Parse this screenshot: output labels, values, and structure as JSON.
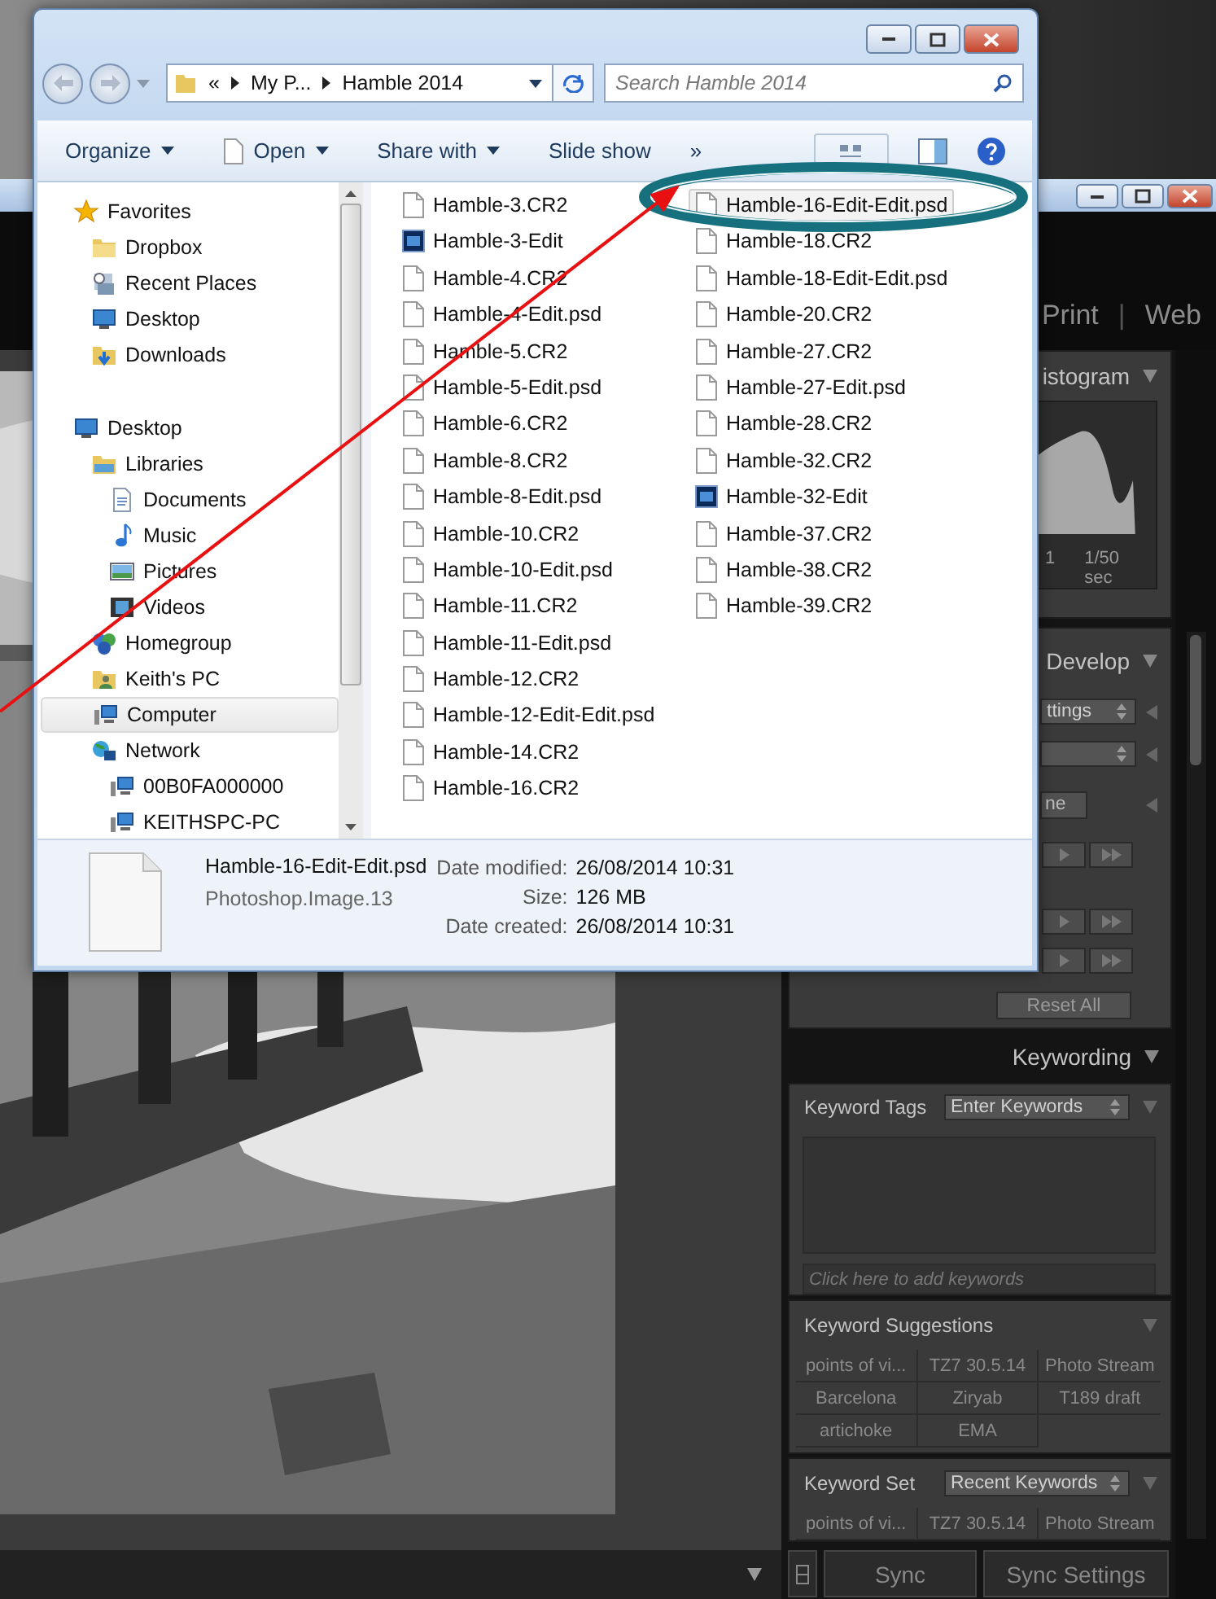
{
  "lightroom": {
    "modules": [
      "Print",
      "Web"
    ],
    "separator": "|",
    "histogram": {
      "title": "istogram",
      "readouts": [
        "1",
        "1/50 sec"
      ]
    },
    "develop": {
      "title": "Develop",
      "preset": "ttings",
      "button": "ne",
      "reset": "Reset All"
    },
    "keywording": {
      "title": "Keywording",
      "tags_label": "Keyword Tags",
      "tags_mode": "Enter Keywords",
      "placeholder": "Click here to add keywords",
      "suggestions_title": "Keyword Suggestions",
      "suggestions": [
        "points of vi...",
        "TZ7 30.5.14",
        "Photo Stream",
        "Barcelona",
        "Ziryab",
        "T189 draft",
        "artichoke",
        "EMA"
      ],
      "set_label": "Keyword Set",
      "set_value": "Recent Keywords",
      "set_keywords": [
        "points of vi...",
        "TZ7 30.5.14",
        "Photo Stream"
      ]
    },
    "sync": [
      "Sync",
      "Sync Settings"
    ]
  },
  "explorer": {
    "address": {
      "overflow": "«",
      "crumbs": [
        "My P...",
        "Hamble 2014"
      ]
    },
    "search": {
      "placeholder": "Search Hamble 2014"
    },
    "toolbar": [
      {
        "label": "Organize",
        "menu": true
      },
      {
        "label": "Open",
        "menu": true
      },
      {
        "label": "Share with",
        "menu": true
      },
      {
        "label": "Slide show",
        "menu": false
      },
      {
        "label": "»",
        "menu": false
      }
    ],
    "nav": [
      {
        "label": "Favorites",
        "kind": "star",
        "selected": false,
        "children": [
          {
            "label": "Dropbox",
            "kind": "folder",
            "selected": false
          },
          {
            "label": "Recent Places",
            "kind": "recent",
            "selected": false
          },
          {
            "label": "Desktop",
            "kind": "desktop",
            "selected": false
          },
          {
            "label": "Downloads",
            "kind": "downloads",
            "selected": false
          }
        ]
      },
      {
        "label": "Desktop",
        "kind": "desktop",
        "selected": false,
        "children": [
          {
            "label": "Libraries",
            "kind": "libraries",
            "selected": false,
            "children": [
              {
                "label": "Documents",
                "kind": "document",
                "selected": false
              },
              {
                "label": "Music",
                "kind": "music",
                "selected": false
              },
              {
                "label": "Pictures",
                "kind": "pictures",
                "selected": false
              },
              {
                "label": "Videos",
                "kind": "videos",
                "selected": false
              }
            ]
          },
          {
            "label": "Homegroup",
            "kind": "homegroup",
            "selected": false
          },
          {
            "label": "Keith's PC",
            "kind": "user",
            "selected": false
          },
          {
            "label": "Computer",
            "kind": "computer",
            "selected": true
          },
          {
            "label": "Network",
            "kind": "network",
            "selected": false,
            "children": [
              {
                "label": "00B0FA000000",
                "kind": "computer",
                "selected": false
              },
              {
                "label": "KEITHSPC-PC",
                "kind": "computer",
                "selected": false
              }
            ]
          }
        ]
      }
    ],
    "files": [
      {
        "name": "Hamble-3.CR2",
        "kind": "file",
        "selected": false
      },
      {
        "name": "Hamble-3-Edit",
        "kind": "photoshop",
        "selected": false
      },
      {
        "name": "Hamble-4.CR2",
        "kind": "file",
        "selected": false
      },
      {
        "name": "Hamble-4-Edit.psd",
        "kind": "file",
        "selected": false
      },
      {
        "name": "Hamble-5.CR2",
        "kind": "file",
        "selected": false
      },
      {
        "name": "Hamble-5-Edit.psd",
        "kind": "file",
        "selected": false
      },
      {
        "name": "Hamble-6.CR2",
        "kind": "file",
        "selected": false
      },
      {
        "name": "Hamble-8.CR2",
        "kind": "file",
        "selected": false
      },
      {
        "name": "Hamble-8-Edit.psd",
        "kind": "file",
        "selected": false
      },
      {
        "name": "Hamble-10.CR2",
        "kind": "file",
        "selected": false
      },
      {
        "name": "Hamble-10-Edit.psd",
        "kind": "file",
        "selected": false
      },
      {
        "name": "Hamble-11.CR2",
        "kind": "file",
        "selected": false
      },
      {
        "name": "Hamble-11-Edit.psd",
        "kind": "file",
        "selected": false
      },
      {
        "name": "Hamble-12.CR2",
        "kind": "file",
        "selected": false
      },
      {
        "name": "Hamble-12-Edit-Edit.psd",
        "kind": "file",
        "selected": false
      },
      {
        "name": "Hamble-14.CR2",
        "kind": "file",
        "selected": false
      },
      {
        "name": "Hamble-16.CR2",
        "kind": "file",
        "selected": false
      },
      {
        "name": "Hamble-16-Edit-Edit.psd",
        "kind": "file",
        "selected": true
      },
      {
        "name": "Hamble-18.CR2",
        "kind": "file",
        "selected": false
      },
      {
        "name": "Hamble-18-Edit-Edit.psd",
        "kind": "file",
        "selected": false
      },
      {
        "name": "Hamble-20.CR2",
        "kind": "file",
        "selected": false
      },
      {
        "name": "Hamble-27.CR2",
        "kind": "file",
        "selected": false
      },
      {
        "name": "Hamble-27-Edit.psd",
        "kind": "file",
        "selected": false
      },
      {
        "name": "Hamble-28.CR2",
        "kind": "file",
        "selected": false
      },
      {
        "name": "Hamble-32.CR2",
        "kind": "file",
        "selected": false
      },
      {
        "name": "Hamble-32-Edit",
        "kind": "photoshop",
        "selected": false
      },
      {
        "name": "Hamble-37.CR2",
        "kind": "file",
        "selected": false
      },
      {
        "name": "Hamble-38.CR2",
        "kind": "file",
        "selected": false
      },
      {
        "name": "Hamble-39.CR2",
        "kind": "file",
        "selected": false
      }
    ],
    "details": {
      "name": "Hamble-16-Edit-Edit.psd",
      "type": "Photoshop.Image.13",
      "properties": [
        {
          "label": "Date modified:",
          "value": "26/08/2014 10:31"
        },
        {
          "label": "Size:",
          "value": "126 MB"
        },
        {
          "label": "Date created:",
          "value": "26/08/2014 10:31"
        }
      ]
    }
  }
}
